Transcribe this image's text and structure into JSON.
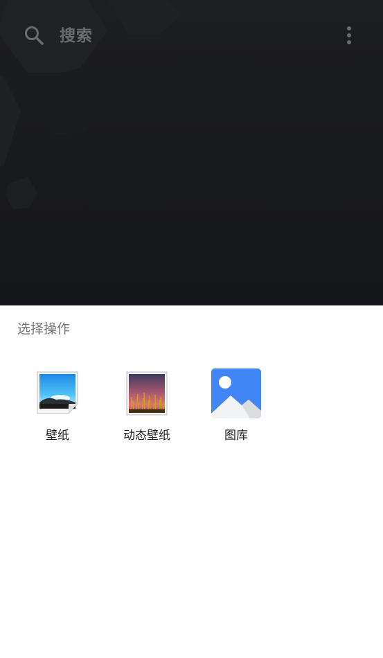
{
  "search": {
    "label": "搜索",
    "icon": "search-icon",
    "menu_icon": "more-vert-icon"
  },
  "sheet": {
    "title": "选择操作",
    "apps": [
      {
        "label": "壁纸",
        "icon": "wallpaper-app-icon"
      },
      {
        "label": "动态壁纸",
        "icon": "live-wallpaper-app-icon"
      },
      {
        "label": "图库",
        "icon": "gallery-app-icon"
      }
    ]
  },
  "colors": {
    "wallpaper_bg": "#17181c",
    "sheet_bg": "#ffffff",
    "gallery_blue": "#4285f4"
  }
}
